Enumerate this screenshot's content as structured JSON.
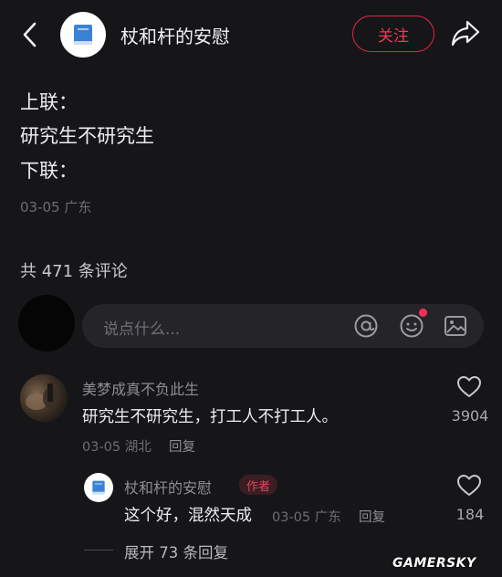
{
  "header": {
    "author_name": "杖和杆的安慰",
    "follow_label": "关注"
  },
  "post": {
    "lines": [
      "上联：",
      "研究生不研究生",
      "下联："
    ],
    "meta": "03-05 广东"
  },
  "comments_header": {
    "count_text": "共 471 条评论"
  },
  "input": {
    "placeholder": "说点什么..."
  },
  "comments": [
    {
      "user": "美梦成真不负此生",
      "text": "研究生不研究生，打工人不打工人。",
      "meta": "03-05 湖北",
      "reply_label": "回复",
      "likes": "3904",
      "replies": [
        {
          "user": "杖和杆的安慰",
          "badge": "作者",
          "text": "这个好，混然天成",
          "meta": "03-05 广东",
          "reply_label": "回复",
          "likes": "184"
        }
      ],
      "expand_text": "展开 73 条回复"
    }
  ],
  "watermark": "GAMERSKY",
  "colors": {
    "background": "#161618",
    "accent": "#e3264a",
    "notification_dot": "#ff2d55"
  }
}
